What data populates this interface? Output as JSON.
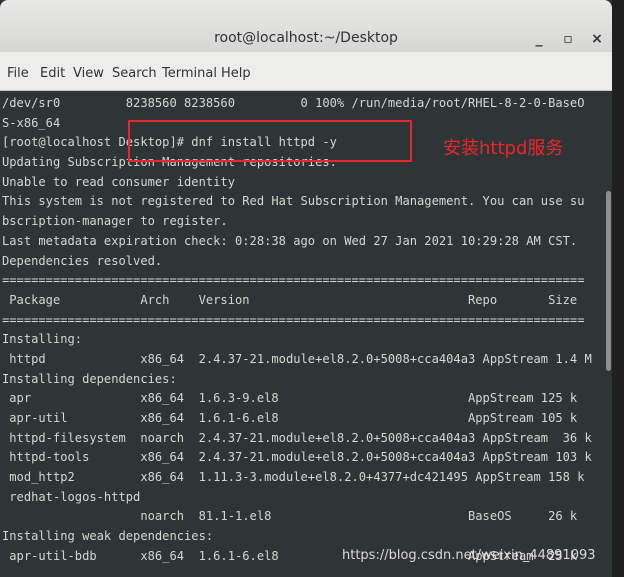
{
  "window": {
    "title": "root@localhost:~/Desktop",
    "minimize_glyph": "_",
    "maximize_glyph": "▫",
    "close_glyph": "×"
  },
  "menubar": {
    "items": [
      "File",
      "Edit",
      "View",
      "Search",
      "Terminal",
      "Help"
    ]
  },
  "terminal": {
    "lines": [
      "/dev/sr0         8238560 8238560         0 100% /run/media/root/RHEL-8-2-0-BaseO",
      "S-x86_64",
      "[root@localhost Desktop]# dnf install httpd -y",
      "Updating Subscription Management repositories.",
      "Unable to read consumer identity",
      "This system is not registered to Red Hat Subscription Management. You can use su",
      "bscription-manager to register.",
      "Last metadata expiration check: 0:28:38 ago on Wed 27 Jan 2021 10:29:28 AM CST.",
      "Dependencies resolved.",
      "================================================================================",
      " Package           Arch    Version                              Repo       Size",
      "================================================================================",
      "Installing:",
      " httpd             x86_64  2.4.37-21.module+el8.2.0+5008+cca404a3 AppStream 1.4 M",
      "Installing dependencies:",
      " apr               x86_64  1.6.3-9.el8                          AppStream 125 k",
      " apr-util          x86_64  1.6.1-6.el8                          AppStream 105 k",
      " httpd-filesystem  noarch  2.4.37-21.module+el8.2.0+5008+cca404a3 AppStream  36 k",
      " httpd-tools       x86_64  2.4.37-21.module+el8.2.0+5008+cca404a3 AppStream 103 k",
      " mod_http2         x86_64  1.11.3-3.module+el8.2.0+4377+dc421495 AppStream 158 k",
      " redhat-logos-httpd",
      "                   noarch  81.1-1.el8                           BaseOS     26 k",
      "Installing weak dependencies:",
      " apr-util-bdb      x86_64  1.6.1-6.el8                          AppStream  25 k"
    ]
  },
  "annotation": {
    "label": "安装httpd服务",
    "color": "#e8262d"
  },
  "watermark": {
    "text": "https://blog.csdn.net/weixin_44891093"
  },
  "colors": {
    "terminal_bg": "#2f3537",
    "terminal_fg": "#d3d7cf",
    "titlebar_bg": "#e0e0df"
  }
}
